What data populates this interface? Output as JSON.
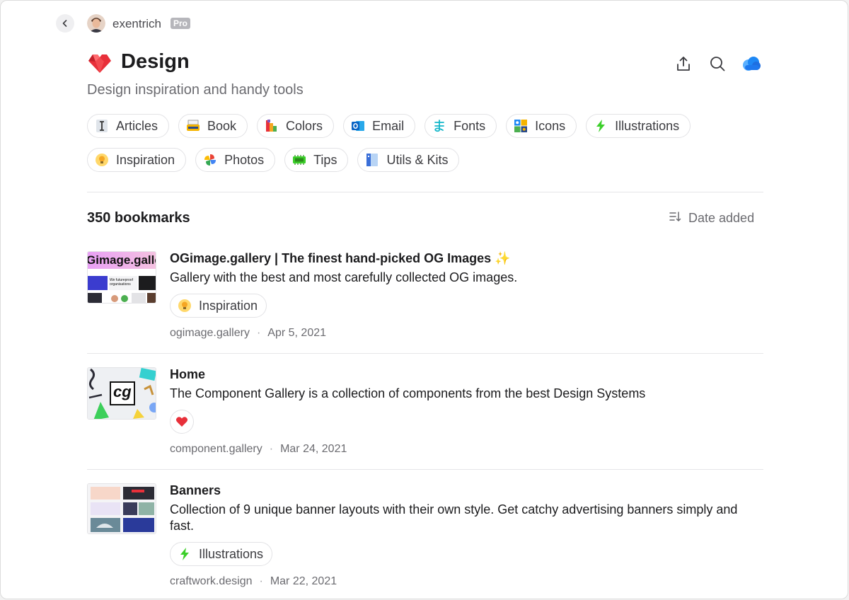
{
  "topbar": {
    "username": "exentrich",
    "badge": "Pro"
  },
  "header": {
    "title": "Design",
    "subtitle": "Design inspiration and handy tools",
    "actions": [
      "share-icon",
      "search-icon",
      "cloud-icon"
    ]
  },
  "tags_row1": [
    {
      "label": "Articles",
      "icon": "text-cursor-icon"
    },
    {
      "label": "Book",
      "icon": "typewriter-icon"
    },
    {
      "label": "Colors",
      "icon": "palette-icon"
    },
    {
      "label": "Email",
      "icon": "outlook-icon"
    },
    {
      "label": "Fonts",
      "icon": "hiragana-icon"
    },
    {
      "label": "Icons",
      "icon": "icon-grid-icon"
    },
    {
      "label": "Illustrations",
      "icon": "lightning-icon"
    }
  ],
  "tags_row2": [
    {
      "label": "Inspiration",
      "icon": "bulb-icon"
    },
    {
      "label": "Photos",
      "icon": "pinwheel-icon"
    },
    {
      "label": "Tips",
      "icon": "chip-icon"
    },
    {
      "label": "Utils & Kits",
      "icon": "book-blue-icon"
    }
  ],
  "list": {
    "count": "350 bookmarks",
    "sort_label": "Date added"
  },
  "bookmarks": [
    {
      "title": "OGimage.gallery | The finest hand-picked OG Images ✨",
      "description": "Gallery with the best and most carefully collected OG images.",
      "tag": "Inspiration",
      "domain": "ogimage.gallery",
      "date": "Apr 5, 2021",
      "thumb_text": "Gimage.galle",
      "thumb_caption": "We futureproof organisations"
    },
    {
      "title": "Home",
      "description": "The Component Gallery is a collection of components from the best Design Systems",
      "tag": "",
      "domain": "component.gallery",
      "date": "Mar 24, 2021",
      "thumb_text": "cg"
    },
    {
      "title": "Banners",
      "description": "Collection of 9 unique banner layouts with their own style. Get catchy advertising banners simply and fast.",
      "tag": "Illustrations",
      "domain": "craftwork.design",
      "date": "Mar 22, 2021"
    }
  ],
  "colors": {
    "accent": "#e8303a",
    "cloud": "#1e88f5",
    "text": "#1c1c1e",
    "muted": "#6b6b70"
  }
}
